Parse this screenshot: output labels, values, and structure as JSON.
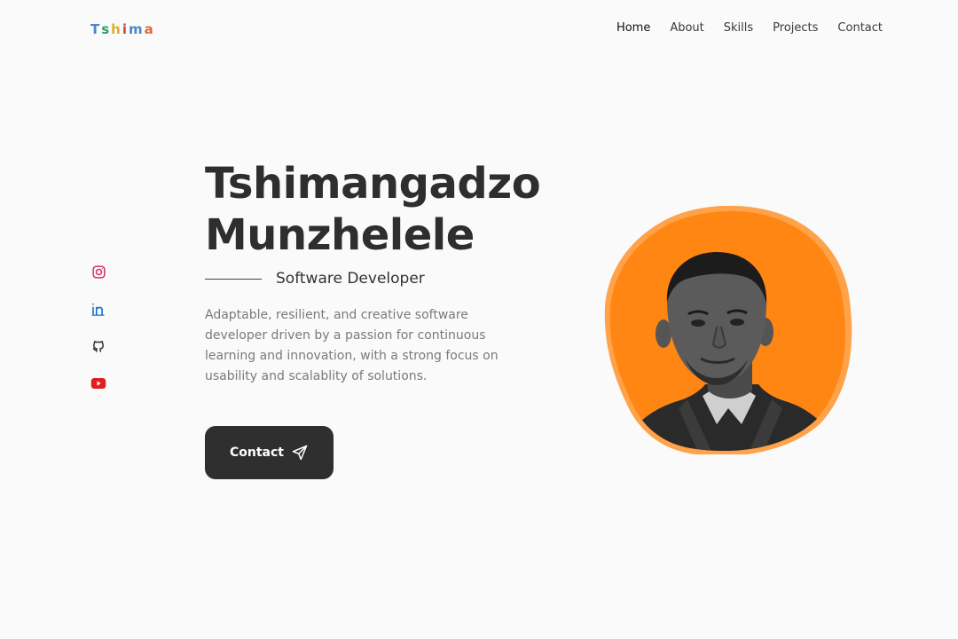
{
  "header": {
    "logo_letters": [
      {
        "char": "T",
        "color": "#4a86c8"
      },
      {
        "char": "s",
        "color": "#2e9e6a"
      },
      {
        "char": "h",
        "color": "#e0b020"
      },
      {
        "char": "i",
        "color": "#d04848"
      },
      {
        "char": "m",
        "color": "#4a86c8"
      },
      {
        "char": "a",
        "color": "#e06a3a"
      }
    ],
    "nav": {
      "home": "Home",
      "about": "About",
      "skills": "Skills",
      "projects": "Projects",
      "contact": "Contact"
    }
  },
  "socials": {
    "instagram": "instagram-icon",
    "linkedin": "linkedin-icon",
    "github": "github-icon",
    "youtube": "youtube-icon"
  },
  "hero": {
    "first_name": "Tshimangadzo",
    "last_name": "Munzhelele",
    "role": "Software Developer",
    "description": "Adaptable, resilient, and creative software developer driven by a passion for continuous learning and innovation, with a strong focus on usability and scalablity of solutions.",
    "cta_label": "Contact",
    "cta_icon": "send-icon"
  },
  "colors": {
    "accent": "#ff8612",
    "accent_light": "#ffa24a",
    "button_bg": "#2f2f2f",
    "page_bg": "#fafafa"
  }
}
